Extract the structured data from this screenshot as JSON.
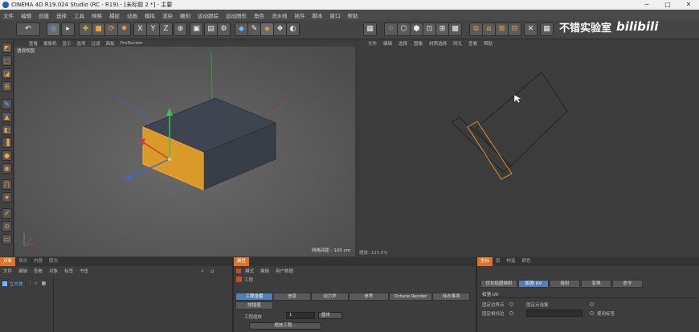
{
  "window": {
    "title": "CINEMA 4D R19.024 Studio (RC - R19) - [未标题 2 *] - 主要",
    "controls": [
      "─",
      "□",
      "✕"
    ]
  },
  "menubar": [
    "文件",
    "编辑",
    "创建",
    "选择",
    "工具",
    "网格",
    "捕捉",
    "动画",
    "模拟",
    "渲染",
    "雕刻",
    "运动跟踪",
    "运动图形",
    "角色",
    "流水线",
    "插件",
    "脚本",
    "窗口",
    "帮助"
  ],
  "left_viewport": {
    "menu": [
      "查看",
      "摄像机",
      "显示",
      "选项",
      "过滤",
      "面板",
      "ProRender"
    ],
    "label": "透视视图",
    "grid_spacing": "网格间距 : 100 cm"
  },
  "right_viewport": {
    "menu": [
      "文件",
      "编辑",
      "选择",
      "图像",
      "材质选择",
      "网孔",
      "查看",
      "帮助"
    ],
    "zoom": "缩放: 125.0%"
  },
  "watermark": {
    "text": "不错实验室",
    "brand": "bilibili"
  },
  "objects_panel": {
    "tabs": [
      "对象",
      "场次",
      "内容",
      "层次"
    ],
    "menu": [
      "文件",
      "编辑",
      "查看",
      "对象",
      "标签",
      "书签"
    ],
    "objects": [
      {
        "name": "立方体"
      }
    ]
  },
  "attributes_panel": {
    "tab": "属性",
    "menu": [
      "模式",
      "编辑",
      "用户数据"
    ],
    "title": "工程",
    "tabs_row1": [
      "工程设置",
      "信息",
      "动力学",
      "参考",
      "Octane Render",
      "待办事项"
    ],
    "tabs_row2": [
      "帧插值"
    ],
    "scale_label": "工程缩放",
    "scale_value": "1",
    "scale_unit": "厘米",
    "scale_button": "缩放工程..."
  },
  "uv_panel": {
    "tabs": [
      "坐标",
      "层",
      "构造",
      "颜色"
    ],
    "tab_buttons": [
      "优化贴图映射",
      "松弛 UV",
      "投射",
      "变换",
      "命令"
    ],
    "section_title": "松弛 UV",
    "options": [
      {
        "label": "固定边界点",
        "checked": false
      },
      {
        "label": "固定点选集",
        "checked": false
      },
      {
        "label": "固定相邻边",
        "checked": false
      },
      {
        "label": "使用标签",
        "checked": false
      }
    ]
  },
  "colors": {
    "accent": "#e0732a",
    "selection": "#f2a23a",
    "axis_x": "#d23a3a",
    "axis_y": "#3ac24a",
    "axis_z": "#3a6ad2"
  }
}
